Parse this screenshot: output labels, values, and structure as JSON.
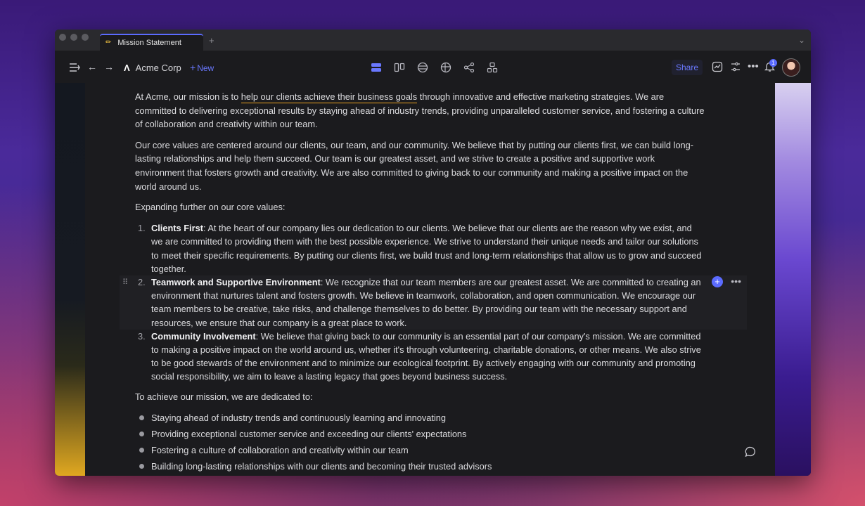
{
  "window": {
    "tab_title": "Mission Statement",
    "tab_icon": "pencil-icon",
    "new_tab_label": "+"
  },
  "toolbar": {
    "workspace": "Acme Corp",
    "workspace_logo": "Λ",
    "new_label": "New",
    "share_label": "Share",
    "notification_count": "1",
    "views": [
      "doc-view-icon",
      "board-view-icon",
      "table-view-icon",
      "grid-view-icon",
      "graph-view-icon",
      "layout-view-icon"
    ],
    "accent": "#5b6bff"
  },
  "document": {
    "intro_pre": "At Acme, our mission is to ",
    "intro_link": "help our clients achieve their business goals",
    "intro_post": " through innovative and effective marketing strategies. We are committed to delivering exceptional results by staying ahead of industry trends, providing unparalleled customer service, and fostering a culture of collaboration and creativity within our team.",
    "core_values": "Our core values are centered around our clients, our team, and our community. We believe that by putting our clients first, we can build long-lasting relationships and help them succeed. Our team is our greatest asset, and we strive to create a positive and supportive work environment that fosters growth and creativity. We are also committed to giving back to our community and making a positive impact on the world around us.",
    "expanding": "Expanding further on our core values:",
    "values": [
      {
        "number": "1.",
        "title": "Clients First",
        "text": ": At the heart of our company lies our dedication to our clients. We believe that our clients are the reason why we exist, and we are committed to providing them with the best possible experience. We strive to understand their unique needs and tailor our solutions to meet their specific requirements. By putting our clients first, we build trust and long-term relationships that allow us to grow and succeed together."
      },
      {
        "number": "2.",
        "title": "Teamwork and Supportive Environment",
        "text": ": We recognize that our team members are our greatest asset. We are committed to creating an environment that nurtures talent and fosters growth. We believe in teamwork, collaboration, and open communication. We encourage our team members to be creative, take risks, and challenge themselves to do better. By providing our team with the necessary support and resources, we ensure that our company is a great place to work."
      },
      {
        "number": "3.",
        "title": "Community Involvement",
        "text": ": We believe that giving back to our community is an essential part of our company's mission. We are committed to making a positive impact on the world around us, whether it's through volunteering, charitable donations, or other means. We also strive to be good stewards of the environment and to minimize our ecological footprint. By actively engaging with our community and promoting social responsibility, we aim to leave a lasting legacy that goes beyond business success."
      }
    ],
    "mission_intro": "To achieve our mission, we are dedicated to:",
    "bullets": [
      "Staying ahead of industry trends and continuously learning and innovating",
      "Providing exceptional customer service and exceeding our clients' expectations",
      "Fostering a culture of collaboration and creativity within our team",
      "Building long-lasting relationships with our clients and becoming their trusted advisors"
    ],
    "underline_color": "#e8a020"
  }
}
